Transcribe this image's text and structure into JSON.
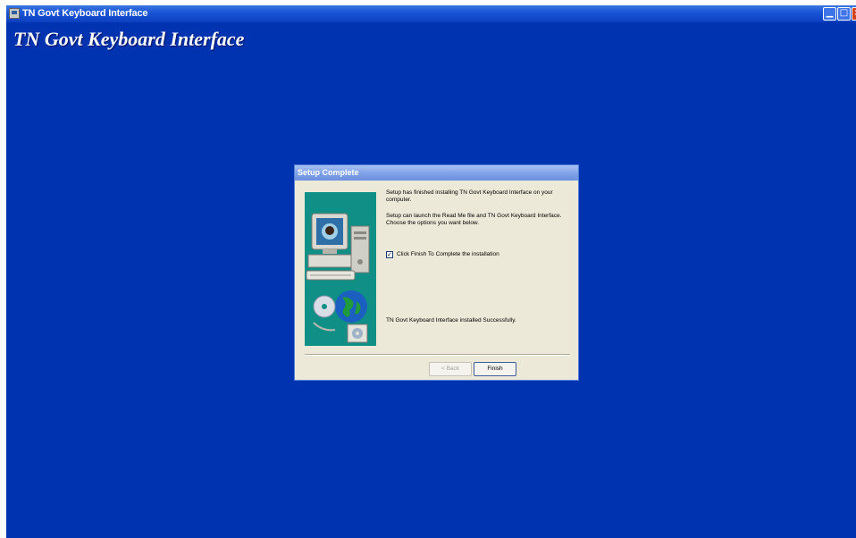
{
  "window": {
    "title": "TN Govt Keyboard Interface",
    "controls": {
      "minimize": "▁",
      "maximize": "□",
      "close": "×"
    }
  },
  "app": {
    "heading": "TN Govt Keyboard Interface"
  },
  "dialog": {
    "title": "Setup Complete",
    "message_finished": "Setup has finished installing TN Govt Keyboard Interface on your computer.",
    "message_launch": "Setup can launch the Read Me file and TN Govt Keyboard Interface.  Choose the options you want below.",
    "checkbox": {
      "label": "Click Finish To Complete the installation",
      "checked": true,
      "mark": "✓"
    },
    "message_success": "TN Govt Keyboard Interface installed Successfully.",
    "buttons": {
      "back": "< Back",
      "finish": "Finish"
    }
  },
  "colors": {
    "desktop": "#0033b0",
    "dialog_bg": "#ece9d8",
    "side_panel": "#0f8f86"
  },
  "icons": [
    "app-icon",
    "computer-globe-illustration"
  ]
}
